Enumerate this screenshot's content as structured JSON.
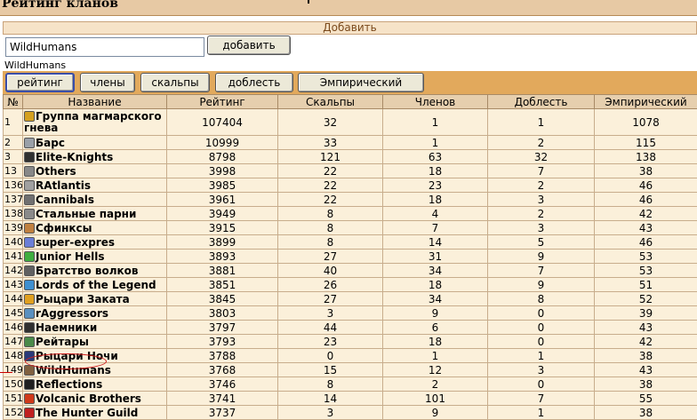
{
  "page": {
    "title": "Рейтинг кланов"
  },
  "add_section": {
    "header": "Добавить",
    "input_value": "WildHumans",
    "button_label": "добавить",
    "current_user": "WildHumans"
  },
  "sort_buttons": [
    {
      "label": "рейтинг",
      "active": true
    },
    {
      "label": "члены"
    },
    {
      "label": "скальпы"
    },
    {
      "label": "доблесть"
    },
    {
      "label": "Эмпирический"
    }
  ],
  "table": {
    "headers": [
      "№",
      "Название",
      "Рейтинг",
      "Скальпы",
      "Членов",
      "Доблесть",
      "Эмпирический"
    ],
    "rows": [
      {
        "n": "1",
        "name": "Группа магмарского гнева",
        "rating": "107404",
        "scalps": "32",
        "members": "1",
        "valor": "1",
        "emp": "1078",
        "icon": "crown-icon",
        "color": "#d4a020"
      },
      {
        "n": "2",
        "name": "Барс",
        "rating": "10999",
        "scalps": "33",
        "members": "1",
        "valor": "2",
        "emp": "115",
        "icon": "snow-leopard-icon",
        "color": "#9aa0a8"
      },
      {
        "n": "3",
        "name": "Elite-Knights",
        "rating": "8798",
        "scalps": "121",
        "members": "63",
        "valor": "32",
        "emp": "138",
        "icon": "sword-icon",
        "color": "#303030"
      },
      {
        "n": "13",
        "name": "Others",
        "rating": "3998",
        "scalps": "22",
        "members": "18",
        "valor": "7",
        "emp": "38",
        "icon": "shield-icon",
        "color": "#888888"
      },
      {
        "n": "136",
        "name": "RAtlantis",
        "rating": "3985",
        "scalps": "22",
        "members": "23",
        "valor": "2",
        "emp": "46",
        "icon": "letter-r-icon",
        "color": "#a0a0a0"
      },
      {
        "n": "137",
        "name": "Cannibals",
        "rating": "3961",
        "scalps": "22",
        "members": "18",
        "valor": "3",
        "emp": "46",
        "icon": "skull-icon",
        "color": "#707070"
      },
      {
        "n": "138",
        "name": "Стальные парни",
        "rating": "3949",
        "scalps": "8",
        "members": "4",
        "valor": "2",
        "emp": "42",
        "icon": "helmet-icon",
        "color": "#8a8a8a"
      },
      {
        "n": "139",
        "name": "Сфинксы",
        "rating": "3915",
        "scalps": "8",
        "members": "7",
        "valor": "3",
        "emp": "43",
        "icon": "sphinx-icon",
        "color": "#c08040"
      },
      {
        "n": "140",
        "name": "super-expres",
        "rating": "3899",
        "scalps": "8",
        "members": "14",
        "valor": "5",
        "emp": "46",
        "icon": "bolt-icon",
        "color": "#6a7ed8"
      },
      {
        "n": "141",
        "name": "Junior Hells",
        "rating": "3893",
        "scalps": "27",
        "members": "31",
        "valor": "9",
        "emp": "53",
        "icon": "snake-icon",
        "color": "#3fae3f"
      },
      {
        "n": "142",
        "name": "Братство волков",
        "rating": "3881",
        "scalps": "40",
        "members": "34",
        "valor": "7",
        "emp": "53",
        "icon": "wolf-icon",
        "color": "#606060"
      },
      {
        "n": "143",
        "name": "Lords of the Legend",
        "rating": "3851",
        "scalps": "26",
        "members": "18",
        "valor": "9",
        "emp": "51",
        "icon": "globe-icon",
        "color": "#3f8fd0"
      },
      {
        "n": "144",
        "name": "Рыцари Заката",
        "rating": "3845",
        "scalps": "27",
        "members": "34",
        "valor": "8",
        "emp": "52",
        "icon": "sunset-icon",
        "color": "#e0a020"
      },
      {
        "n": "145",
        "name": "rAggressors",
        "rating": "3803",
        "scalps": "3",
        "members": "9",
        "valor": "0",
        "emp": "39",
        "icon": "sword-shield-icon",
        "color": "#5a90c0"
      },
      {
        "n": "146",
        "name": "Наемники",
        "rating": "3797",
        "scalps": "44",
        "members": "6",
        "valor": "0",
        "emp": "43",
        "icon": "cross-icon",
        "color": "#303030"
      },
      {
        "n": "147",
        "name": "Рейтары",
        "rating": "3793",
        "scalps": "23",
        "members": "18",
        "valor": "0",
        "emp": "42",
        "icon": "trident-icon",
        "color": "#4a8a4a"
      },
      {
        "n": "148",
        "name": "Рыцари Ночи",
        "rating": "3788",
        "scalps": "0",
        "members": "1",
        "valor": "1",
        "emp": "38",
        "icon": "moon-shield-icon",
        "color": "#2a3a7a"
      },
      {
        "n": "149",
        "name": "WildHumans",
        "rating": "3768",
        "scalps": "15",
        "members": "12",
        "valor": "3",
        "emp": "43",
        "icon": "paw-icon",
        "color": "#806040"
      },
      {
        "n": "150",
        "name": "Reflections",
        "rating": "3746",
        "scalps": "8",
        "members": "2",
        "valor": "0",
        "emp": "38",
        "icon": "mirror-icon",
        "color": "#202020"
      },
      {
        "n": "151",
        "name": "Volcanic Brothers",
        "rating": "3741",
        "scalps": "14",
        "members": "101",
        "valor": "7",
        "emp": "55",
        "icon": "volcano-icon",
        "color": "#d03a1a"
      },
      {
        "n": "152",
        "name": "The Hunter Guild",
        "rating": "3737",
        "scalps": "3",
        "members": "9",
        "valor": "1",
        "emp": "38",
        "icon": "heart-icon",
        "color": "#c02020"
      }
    ]
  }
}
